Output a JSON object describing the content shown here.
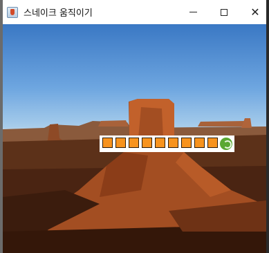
{
  "window": {
    "title": "스네이크 움직이기",
    "controls": {
      "minimize": "minimize",
      "maximize": "maximize",
      "close": "✕"
    }
  },
  "game": {
    "body_segment_count": 9,
    "body_color": "#f7931e",
    "head_color": "#5aa832",
    "background": "desert-mesa-photo"
  }
}
